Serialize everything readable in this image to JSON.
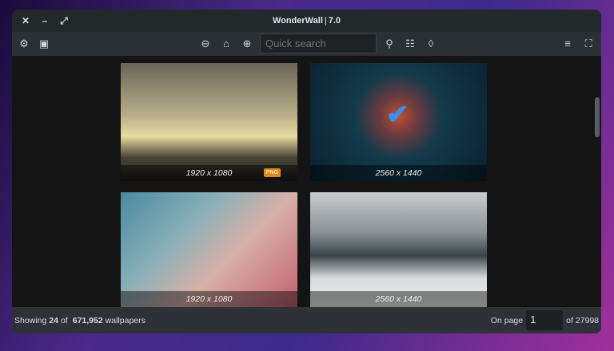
{
  "window": {
    "title": "WonderWall",
    "version": "7.0"
  },
  "toolbar": {
    "search_placeholder": "Quick search"
  },
  "thumbnails": [
    {
      "resolution": "1920 x 1080",
      "badge": "PNG"
    },
    {
      "resolution": "2560 x 1440"
    },
    {
      "resolution": "1920 x 1080"
    },
    {
      "resolution": "2560 x 1440"
    }
  ],
  "status": {
    "showing_label": "Showing",
    "shown": "24",
    "of_label": "of",
    "total": "671,952",
    "suffix": "wallpapers",
    "on_page_label": "On page",
    "page": "1",
    "of_pages": "of 27998"
  }
}
